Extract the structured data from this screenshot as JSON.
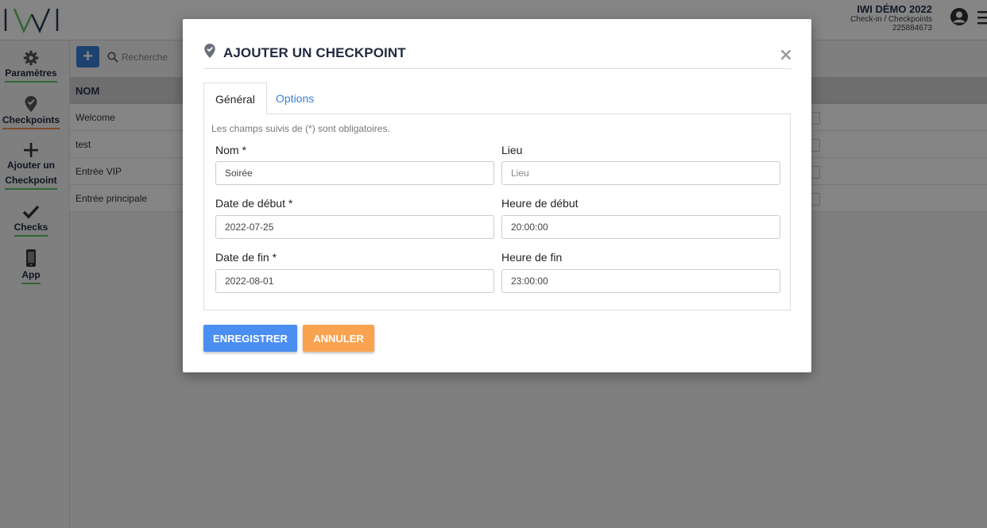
{
  "header": {
    "event_title": "IWI DÉMO 2022",
    "breadcrumb": "Check-in / Checkpoints",
    "event_id": "225884673"
  },
  "sidebar": {
    "items": [
      {
        "label": "Paramètres",
        "icon": "gear-icon"
      },
      {
        "label": "Checkpoints",
        "icon": "map-pin-check-icon"
      },
      {
        "label_line1": "Ajouter un",
        "label_line2": "Checkpoint",
        "icon": "plus-icon"
      },
      {
        "label": "Checks",
        "icon": "checkmark-icon"
      },
      {
        "label": "App",
        "icon": "mobile-phone-icon"
      }
    ]
  },
  "list": {
    "add_label": "+",
    "search_placeholder": "Recherche",
    "column_header": "NOM",
    "rows": [
      "Welcome",
      "test",
      "Entrée VIP",
      "Entrée principale"
    ]
  },
  "modal": {
    "title": "AJOUTER UN CHECKPOINT",
    "tabs": [
      "Général",
      "Options"
    ],
    "required_note": "Les champs suivis de (*) sont obligatoires.",
    "fields": {
      "nom": {
        "label": "Nom *",
        "value": "Soirée"
      },
      "lieu": {
        "label": "Lieu",
        "placeholder": "Lieu"
      },
      "date_debut": {
        "label": "Date de début *",
        "value": "2022-07-25"
      },
      "heure_debut": {
        "label": "Heure de début",
        "value": "20:00:00"
      },
      "date_fin": {
        "label": "Date de fin *",
        "value": "2022-08-01"
      },
      "heure_fin": {
        "label": "Heure de fin",
        "value": "23:00:00"
      }
    },
    "save_label": "ENREGISTRER",
    "cancel_label": "ANNULER"
  },
  "colors": {
    "primary": "#4a8ef2",
    "cancel": "#f9a24f",
    "nav_text": "#1d2a3e",
    "underline_green": "#5ec26a",
    "underline_orange": "#f2955a"
  }
}
